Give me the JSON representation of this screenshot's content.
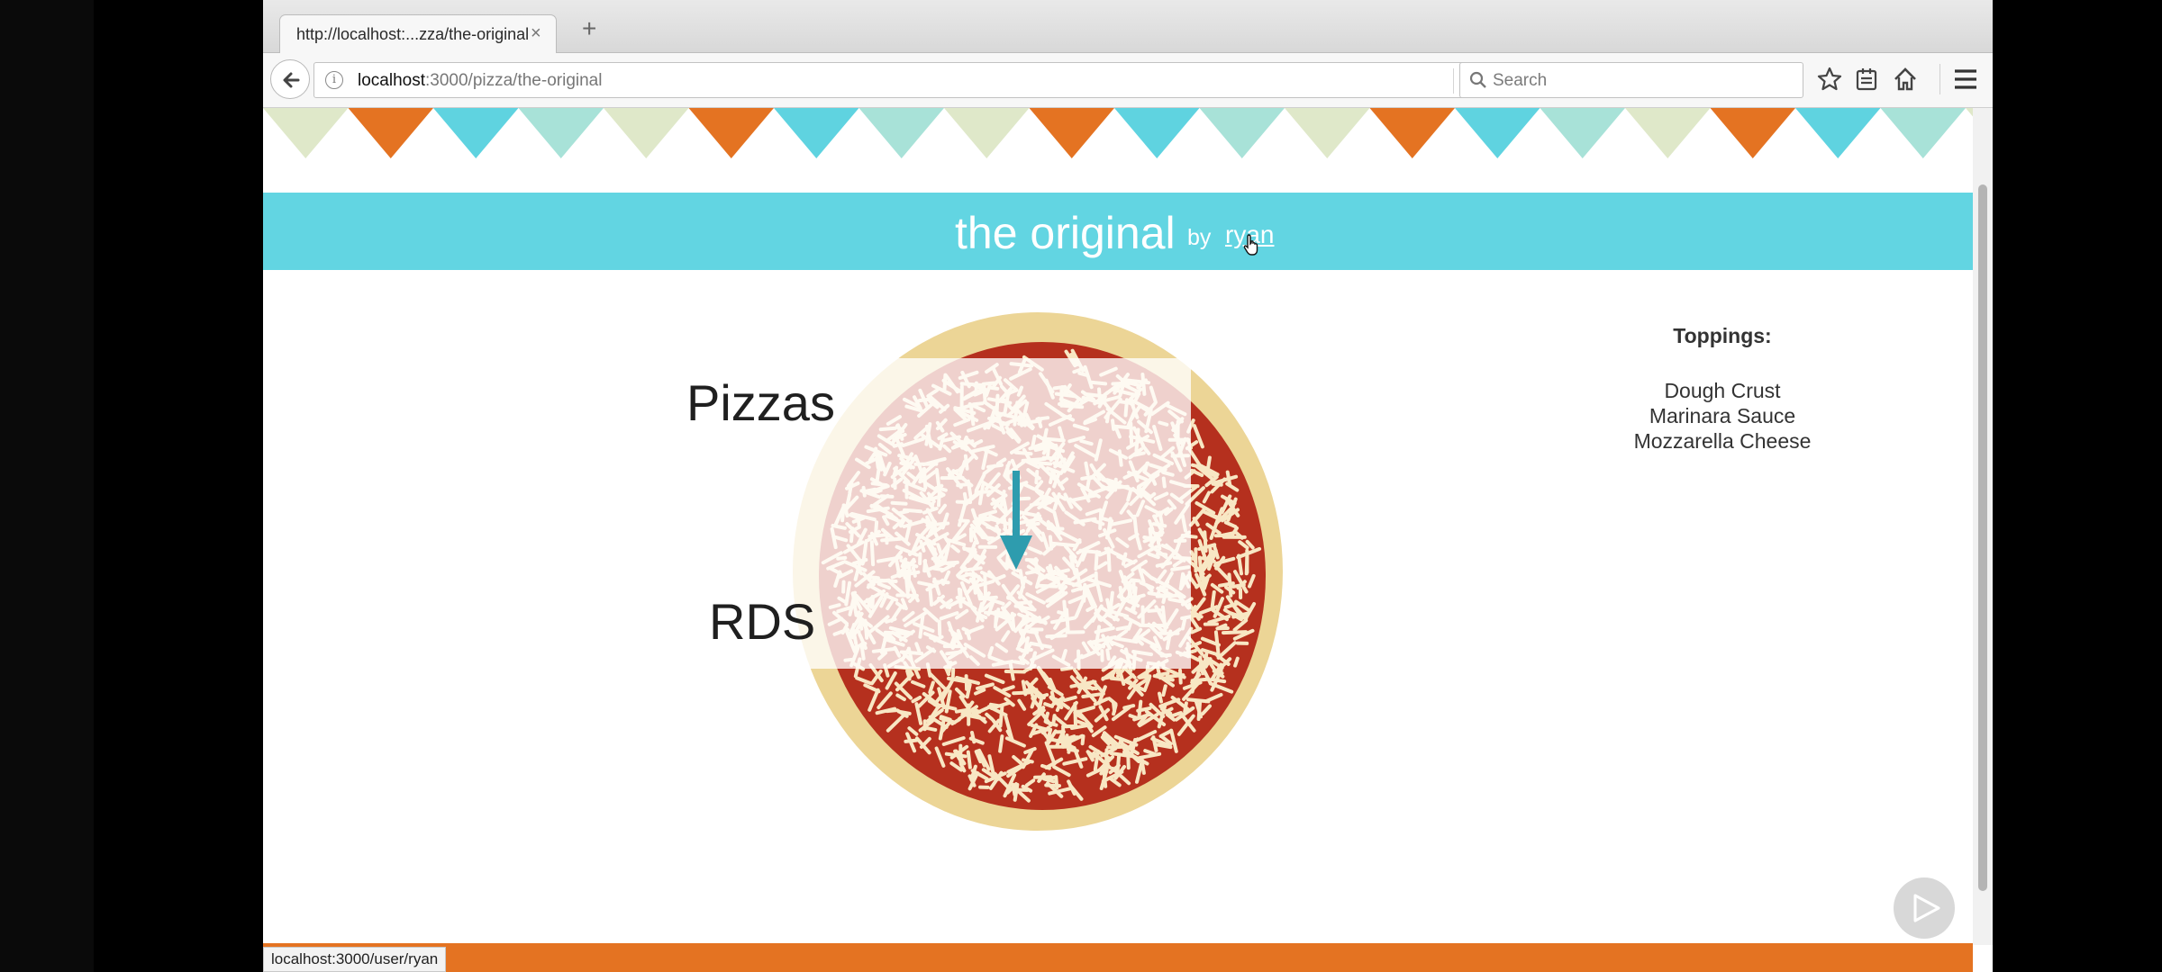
{
  "browser": {
    "tab_title": "http://localhost:...zza/the-original",
    "tab_close": "×",
    "new_tab": "+",
    "url_host": "localhost",
    "url_path": ":3000/pizza/the-original",
    "search_placeholder": "Search",
    "status_url": "localhost:3000/user/ryan"
  },
  "header": {
    "title": "the original",
    "by_label": "by",
    "user_link": "ryan"
  },
  "overlay": {
    "from_label": "Pizzas",
    "to_label": "RDS"
  },
  "toppings": {
    "heading": "Toppings:",
    "items": [
      "Dough Crust",
      "Marinara Sauce",
      "Mozzarella Cheese"
    ]
  },
  "colors": {
    "banner": "#62d5e2",
    "footer": "#e47322",
    "bunting": [
      "#dfe8c9",
      "#e47322",
      "#5fd3e0",
      "#a8e2d8"
    ],
    "crust": "#ecd596",
    "sauce": "#b5301e",
    "cheese": "#f8e7c4"
  }
}
